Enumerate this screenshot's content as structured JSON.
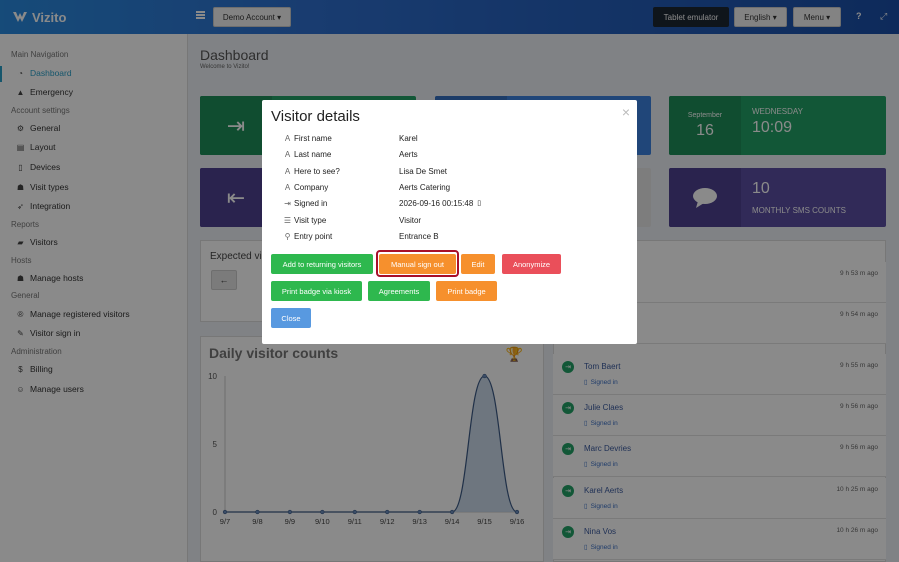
{
  "app": {
    "brand": "Vizito"
  },
  "header": {
    "account_button": "Demo Account ▾",
    "tablet_button": "Tablet emulator",
    "language_button": "English ▾",
    "menu_button": "Menu ▾",
    "help_icon": "?",
    "expand_icon": "⤢"
  },
  "sidebar": {
    "sections": [
      {
        "title": "Main Navigation",
        "items": [
          {
            "label": "Dashboard",
            "icon": "dashboard-icon",
            "active": true
          },
          {
            "label": "Emergency",
            "icon": "warning-icon"
          }
        ]
      },
      {
        "title": "Account settings",
        "items": [
          {
            "label": "General",
            "icon": "gear-icon"
          },
          {
            "label": "Layout",
            "icon": "layout-icon"
          },
          {
            "label": "Devices",
            "icon": "devices-icon"
          },
          {
            "label": "Visit types",
            "icon": "users-icon"
          },
          {
            "label": "Integration",
            "icon": "rocket-icon"
          }
        ]
      },
      {
        "title": "Reports",
        "items": [
          {
            "label": "Visitors",
            "icon": "book-icon"
          }
        ]
      },
      {
        "title": "Hosts",
        "items": [
          {
            "label": "Manage hosts",
            "icon": "users-icon"
          }
        ]
      },
      {
        "title": "General",
        "items": [
          {
            "label": "Manage registered visitors",
            "icon": "registered-icon"
          },
          {
            "label": "Visitor sign in",
            "icon": "pencil-icon"
          }
        ]
      },
      {
        "title": "Administration",
        "items": [
          {
            "label": "Billing",
            "icon": "dollar-icon"
          },
          {
            "label": "Manage users",
            "icon": "user-plus-icon"
          }
        ]
      }
    ]
  },
  "page": {
    "title": "Dashboard",
    "subtitle": "Welcome to Vizito!"
  },
  "tiles": {
    "date": {
      "month": "September",
      "day": "16",
      "weekday": "WEDNESDAY",
      "time": "10:09"
    },
    "sms": {
      "count": "10",
      "label": "MONTHLY SMS COUNTS"
    }
  },
  "expected": {
    "title": "Expected vis"
  },
  "chart": {
    "title": "Daily visitor counts"
  },
  "chart_data": {
    "type": "area",
    "title": "Daily visitor counts",
    "x": [
      "9/7",
      "9/8",
      "9/9",
      "9/10",
      "9/11",
      "9/12",
      "9/13",
      "9/14",
      "9/15",
      "9/16"
    ],
    "values": [
      0,
      0,
      0,
      0,
      0,
      0,
      0,
      0,
      10,
      0
    ],
    "ylim": [
      0,
      10
    ],
    "yticks": [
      "10",
      "5",
      "0"
    ],
    "colors": {
      "line": "#3b5a85",
      "fill": "#c2d3e8"
    }
  },
  "recent_visitors": [
    {
      "name": "",
      "status": "",
      "time": "9 h 53 m ago"
    },
    {
      "name": "",
      "status": "",
      "time": "9 h 54 m ago"
    },
    {
      "name": "Tom Baert",
      "status": "Signed in",
      "time": "9 h 55 m ago"
    },
    {
      "name": "Julie Claes",
      "status": "Signed in",
      "time": "9 h 56 m ago"
    },
    {
      "name": "Marc Devries",
      "status": "Signed in",
      "time": "9 h 56 m ago"
    },
    {
      "name": "Karel Aerts",
      "status": "Signed in",
      "time": "10 h 25 m ago"
    },
    {
      "name": "Nina Vos",
      "status": "Signed in",
      "time": "10 h 26 m ago"
    }
  ],
  "modal": {
    "title": "Visitor details",
    "close": "×",
    "fields": [
      {
        "icon": "font-icon",
        "label": "First name",
        "value": "Karel"
      },
      {
        "icon": "font-icon",
        "label": "Last name",
        "value": "Aerts"
      },
      {
        "icon": "font-icon",
        "label": "Here to see?",
        "value": "Lisa De Smet"
      },
      {
        "icon": "font-icon",
        "label": "Company",
        "value": "Aerts Catering"
      },
      {
        "icon": "sign-in-icon",
        "label": "Signed in",
        "value": "2026-09-16 00:15:48"
      },
      {
        "icon": "list-icon",
        "label": "Visit type",
        "value": "Visitor"
      },
      {
        "icon": "map-marker-icon",
        "label": "Entry point",
        "value": "Entrance B"
      }
    ],
    "buttons": {
      "add_returning": "Add to returning visitors",
      "manual_signout": "Manual sign out",
      "edit": "Edit",
      "anonymize": "Anonymize",
      "print_kiosk": "Print badge via kiosk",
      "agreements": "Agreements",
      "print_badge": "Print badge",
      "close": "Close"
    }
  }
}
